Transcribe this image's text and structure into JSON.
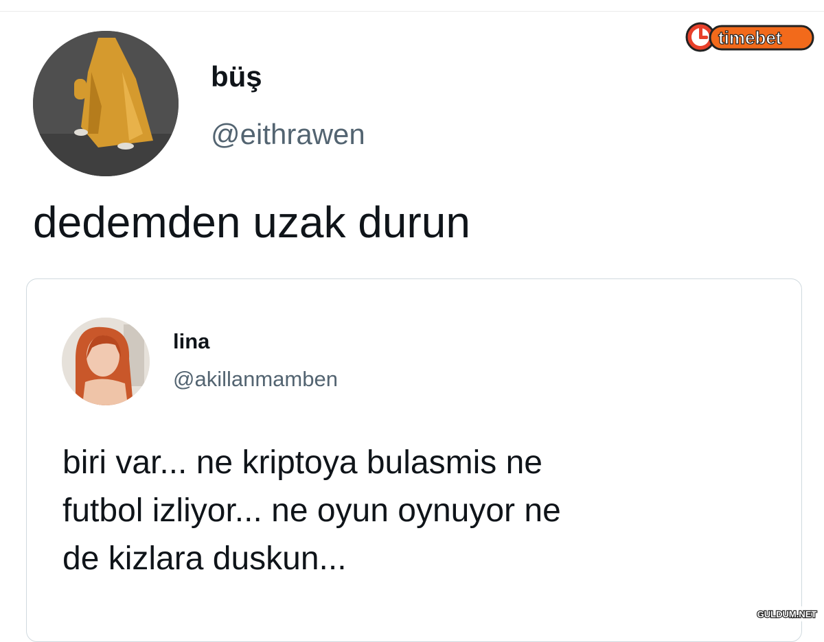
{
  "main_tweet": {
    "author_name": "büş",
    "author_handle": "@eithrawen",
    "text": "dedemden uzak durun"
  },
  "quoted_tweet": {
    "author_name": "lina",
    "author_handle": "@akillanmamben",
    "text_lines": [
      "biri var... ne kriptoya bulasmis ne",
      "futbol izliyor... ne oyun oynuyor ne",
      "de kizlara duskun..."
    ]
  },
  "watermarks": {
    "top_right": "timebet",
    "bottom_right": "GULDUM.NET"
  },
  "colors": {
    "text_primary": "#0f1419",
    "text_secondary": "#536471",
    "card_border": "#cfd9de",
    "brand_red": "#e8402a",
    "brand_orange": "#f26a1b"
  }
}
